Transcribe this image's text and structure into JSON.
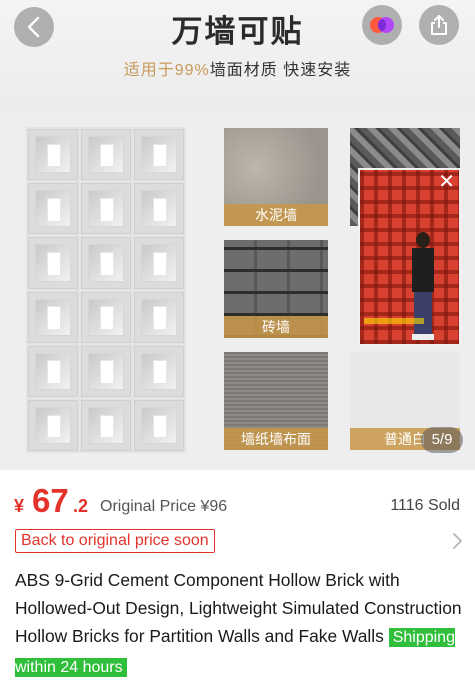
{
  "hero": {
    "title": "万墙可贴",
    "subtitle_highlight": "适用于99%",
    "subtitle_rest": "墙面材质 快速安装",
    "materials": [
      "水泥墙",
      "砖墙",
      "墙纸墙布面",
      "普通白"
    ],
    "page_indicator": "5/9",
    "video_close": "✕"
  },
  "toolbar": {
    "back_icon": "chevron-left-icon",
    "share_icon": "share-icon",
    "app_icon": "app-logo-icon"
  },
  "price": {
    "currency": "¥",
    "integer": "67",
    "decimal": ".2",
    "original": "Original Price ¥96",
    "sold": "1116 Sold"
  },
  "promo": {
    "back_to_price": "Back to original price soon"
  },
  "product": {
    "title": "ABS 9-Grid Cement Component Hollow Brick with Hollowed-Out Design, Lightweight Simulated Construction Hollow Bricks for Partition Walls and Fake Walls",
    "shipping_badge": "Shipping within 24 hours"
  },
  "colors": {
    "price_red": "#e4322b",
    "shipping_green": "#2fbf3a",
    "label_gold": "#c89a5a"
  }
}
